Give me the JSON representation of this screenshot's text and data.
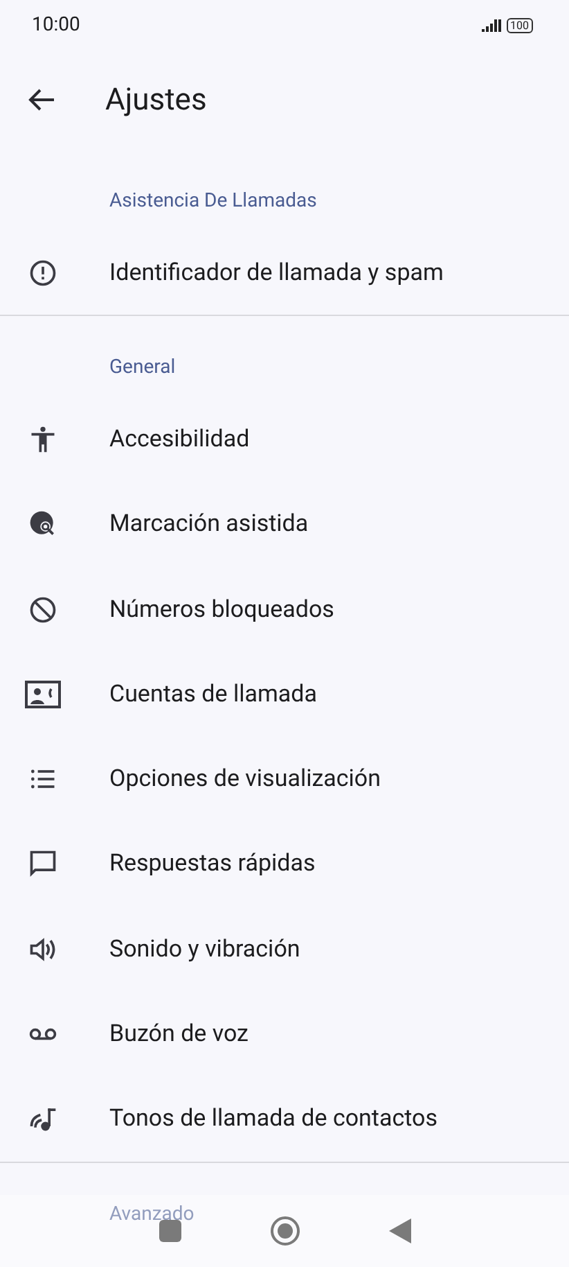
{
  "status_bar": {
    "time": "10:00",
    "battery": "100"
  },
  "header": {
    "title": "Ajustes"
  },
  "sections": [
    {
      "heading": "Asistencia De Llamadas",
      "items": [
        {
          "label": "Identificador de llamada y spam"
        }
      ]
    },
    {
      "heading": "General",
      "items": [
        {
          "label": "Accesibilidad"
        },
        {
          "label": "Marcación asistida"
        },
        {
          "label": "Números bloqueados"
        },
        {
          "label": "Cuentas de llamada"
        },
        {
          "label": "Opciones de visualización"
        },
        {
          "label": "Respuestas rápidas"
        },
        {
          "label": "Sonido y vibración"
        },
        {
          "label": "Buzón de voz"
        },
        {
          "label": "Tonos de llamada de contactos"
        }
      ]
    },
    {
      "heading": "Avanzado"
    }
  ]
}
